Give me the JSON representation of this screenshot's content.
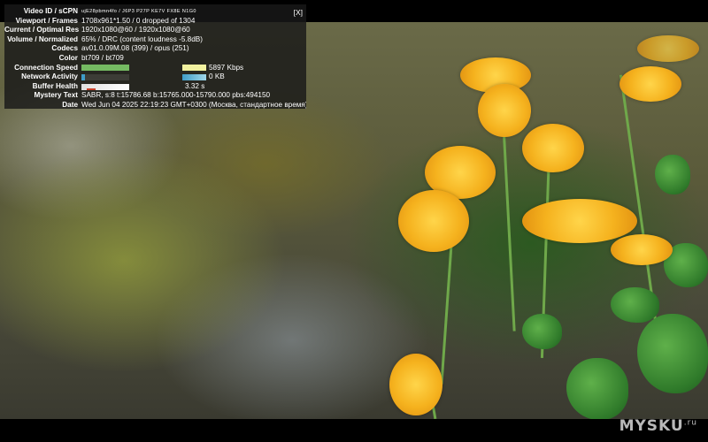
{
  "stats": {
    "close_label": "[X]",
    "rows": [
      {
        "label": "Video ID / sCPN",
        "value": "ujE28pbmn4fo / J6P3 P27P KE7V FX8E N1G0"
      },
      {
        "label": "Viewport / Frames",
        "value": "1708x961*1.50 / 0 dropped of 1304"
      },
      {
        "label": "Current / Optimal Res",
        "value": "1920x1080@60 / 1920x1080@60"
      },
      {
        "label": "Volume / Normalized",
        "value": "65% / DRC (content loudness -5.8dB)"
      },
      {
        "label": "Codecs",
        "value": "av01.0.09M.08 (399) / opus (251)"
      },
      {
        "label": "Color",
        "value": "bt709 / bt709"
      },
      {
        "label": "Connection Speed",
        "value": "5897 Kbps"
      },
      {
        "label": "Network Activity",
        "value": "0 KB"
      },
      {
        "label": "Buffer Health",
        "value": "3.32 s"
      },
      {
        "label": "Mystery Text",
        "value": "SABR, s:8 t:15786.68 b:15765.000-15790.000 pbs:494150"
      },
      {
        "label": "Date",
        "value": "Wed Jun 04 2025 22:19:23 GMT+0300 (Москва, стандартное время)"
      }
    ],
    "colors": {
      "connection": "#7fd06a",
      "network": "#3f9cc7",
      "network_right": "#9fd6e8",
      "connection_right": "#f1f19f",
      "buffer_mark": "#c8402a"
    }
  },
  "watermark": {
    "text": "MYSKU",
    "suffix": ".ru"
  }
}
